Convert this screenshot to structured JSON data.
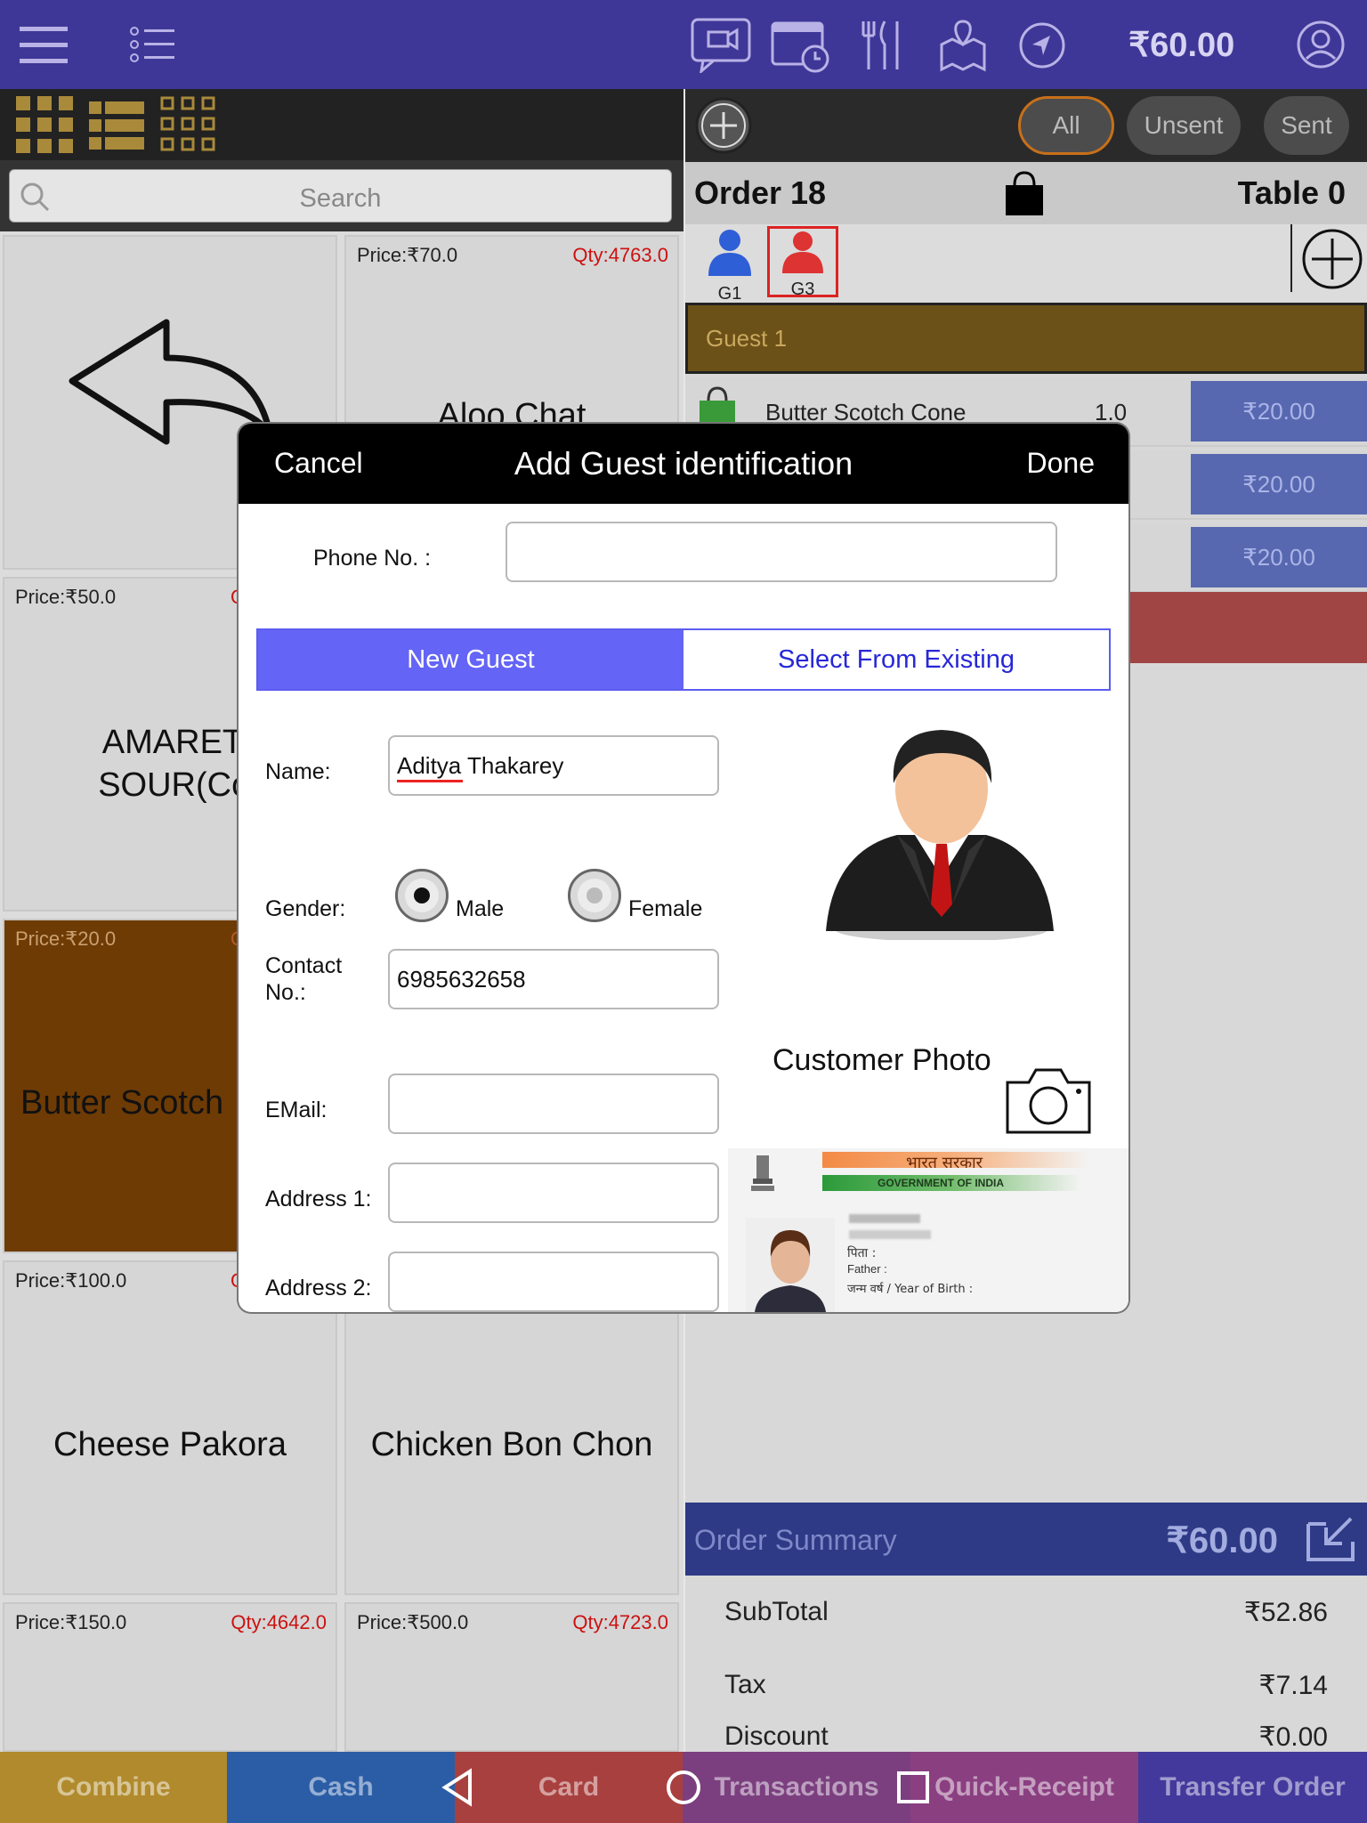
{
  "topbar": {
    "amount": "₹60.00",
    "icons": [
      "menu-icon",
      "list-icon",
      "chat-icon",
      "calendar-icon",
      "dining-icon",
      "map-icon",
      "navigation-icon",
      "user-icon"
    ]
  },
  "left": {
    "search_placeholder": "Search",
    "tiles": [
      {
        "price": "",
        "qty": "",
        "name": ""
      },
      {
        "price": "Price:₹70.0",
        "qty": "Qty:4763.0",
        "name": "Aloo Chat"
      },
      {
        "price": "Price:₹50.0",
        "qty": "Q",
        "name": "AMARETTO SOUR(Cockt"
      },
      {
        "price": "Price:₹20.0",
        "qty": "Q",
        "name": "Butter Scotch"
      },
      {
        "price": "Price:₹100.0",
        "qty": "Q",
        "name": "Cheese Pakora"
      },
      {
        "price": "",
        "qty": "",
        "name": "Chicken Bon Chon"
      },
      {
        "price": "Price:₹150.0",
        "qty": "Qty:4642.0",
        "name": ""
      },
      {
        "price": "Price:₹500.0",
        "qty": "Qty:4723.0",
        "name": ""
      }
    ]
  },
  "right": {
    "filters": [
      "All",
      "Unsent",
      "Sent"
    ],
    "order_title": "Order 18",
    "table_title": "Table 0",
    "guests": [
      "G1",
      "G3"
    ],
    "guest_section": "Guest 1",
    "items": [
      {
        "name": "Butter Scotch Cone",
        "qty": "1.0",
        "price": "₹20.00"
      },
      {
        "name": "",
        "qty": "",
        "price": "₹20.00"
      },
      {
        "name": "",
        "qty": "",
        "price": "₹20.00"
      }
    ],
    "summary": {
      "label": "Order Summary",
      "total": "₹60.00"
    },
    "rows": [
      {
        "label": "SubTotal",
        "value": "₹52.86"
      },
      {
        "label": "Tax",
        "value": "₹7.14"
      },
      {
        "label": "Discount",
        "value": "₹0.00"
      }
    ]
  },
  "bottom": {
    "buttons": [
      {
        "label": "Combine",
        "color": "#b08a2c"
      },
      {
        "label": "Cash",
        "color": "#2b5da6"
      },
      {
        "label": "Card",
        "color": "#a8403f"
      },
      {
        "label": "Transactions",
        "color": "#7b3f7f"
      },
      {
        "label": "Quick-Receipt",
        "color": "#8a3f81"
      },
      {
        "label": "Transfer Order",
        "color": "#43399c"
      }
    ]
  },
  "modal": {
    "cancel": "Cancel",
    "title": "Add Guest identification",
    "done": "Done",
    "phone_label": "Phone No. :",
    "phone_value": "",
    "tab_new": "New Guest",
    "tab_existing": "Select From Existing",
    "name_label": "Name:",
    "name_value": "Aditya Thakarey",
    "gender_label": "Gender:",
    "male": "Male",
    "female": "Female",
    "contact_label": "Contact No.:",
    "contact_value": "6985632658",
    "email_label": "EMail:",
    "email_value": "",
    "address1_label": "Address 1:",
    "address1_value": "",
    "address2_label": "Address 2:",
    "address2_value": "",
    "photo_label": "Customer Photo",
    "id_card": {
      "line1": "भारत सरकार",
      "line2": "GOVERNMENT OF INDIA",
      "line3": "पिता :",
      "line4": "Father :",
      "line5": "जन्म वर्ष / Year of Birth :"
    }
  }
}
